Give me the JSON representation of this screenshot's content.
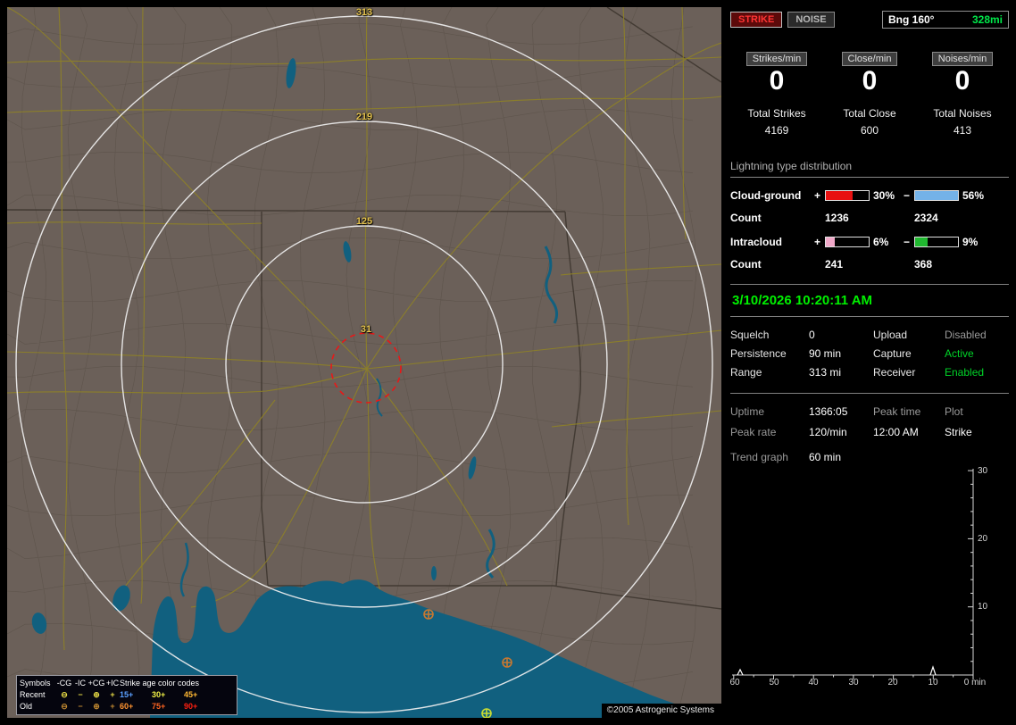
{
  "window": {
    "copyright": "©2005 Astrogenic Systems"
  },
  "map": {
    "rings": [
      {
        "label": "313"
      },
      {
        "label": "219"
      },
      {
        "label": "125"
      },
      {
        "label": "31"
      }
    ],
    "legend": {
      "symbols_title": "Symbols",
      "symbol_headers": [
        "-CG",
        "-IC",
        "+CG",
        "+IC"
      ],
      "age_title": "Strike age color codes",
      "recent_label": "Recent",
      "old_label": "Old",
      "recent_symbols": [
        "⊖",
        "−",
        "⊕",
        "+"
      ],
      "old_symbols": [
        "⊖",
        "−",
        "⊕",
        "+"
      ],
      "recent_ages": [
        {
          "text": "15+",
          "color": "#5aa0ff"
        },
        {
          "text": "30+",
          "color": "#f0f046"
        },
        {
          "text": "45+",
          "color": "#ffb833"
        }
      ],
      "old_ages": [
        {
          "text": "60+",
          "color": "#ff9430"
        },
        {
          "text": "75+",
          "color": "#ff6420"
        },
        {
          "text": "90+",
          "color": "#ff2010"
        }
      ]
    }
  },
  "panel": {
    "strike_button": "STRIKE",
    "noise_button": "NOISE",
    "bearing_label": "Bng 160°",
    "bearing_value": "328mi",
    "counters": [
      {
        "label": "Strikes/min",
        "value": "0",
        "total_label": "Total Strikes",
        "total": "4169"
      },
      {
        "label": "Close/min",
        "value": "0",
        "total_label": "Total Close",
        "total": "600"
      },
      {
        "label": "Noises/min",
        "value": "0",
        "total_label": "Total Noises",
        "total": "413"
      }
    ],
    "distribution": {
      "title": "Lightning type distribution",
      "cloud_ground": {
        "label": "Cloud-ground",
        "plus_sign": "+",
        "minus_sign": "−",
        "pos_pct": "30%",
        "pos_fill": 62,
        "pos_color": "#e81010",
        "neg_pct": "56%",
        "neg_fill": 100,
        "neg_color": "#74b2e8",
        "count_label": "Count",
        "pos_count": "1236",
        "neg_count": "2324"
      },
      "intracloud": {
        "label": "Intracloud",
        "plus_sign": "+",
        "minus_sign": "−",
        "pos_pct": "6%",
        "pos_fill": 20,
        "pos_color": "#f0a8c8",
        "neg_pct": "9%",
        "neg_fill": 30,
        "neg_color": "#20b830",
        "count_label": "Count",
        "pos_count": "241",
        "neg_count": "368"
      }
    },
    "clock": "3/10/2026 10:20:11 AM",
    "settings": {
      "rows": [
        {
          "label1": "Squelch",
          "value1": "0",
          "label2": "Upload",
          "value2": "Disabled"
        },
        {
          "label1": "Persistence",
          "value1": "90 min",
          "label2": "Capture",
          "value2": "Active"
        },
        {
          "label1": "Range",
          "value1": "313 mi",
          "label2": "Receiver",
          "value2": "Enabled"
        }
      ]
    },
    "stats": {
      "uptime_label": "Uptime",
      "uptime_value": "1366:05",
      "peak_time_label": "Peak time",
      "plot_label": "Plot",
      "peak_rate_label": "Peak rate",
      "peak_rate_value": "120/min",
      "peak_time_value": "12:00 AM",
      "plot_value": "Strike",
      "trend_label": "Trend graph",
      "trend_value": "60 min"
    },
    "graph": {
      "y_ticks": [
        "30",
        "20",
        "10"
      ],
      "x_ticks": [
        "60",
        "50",
        "40",
        "30",
        "20",
        "10",
        "0 min"
      ]
    }
  }
}
